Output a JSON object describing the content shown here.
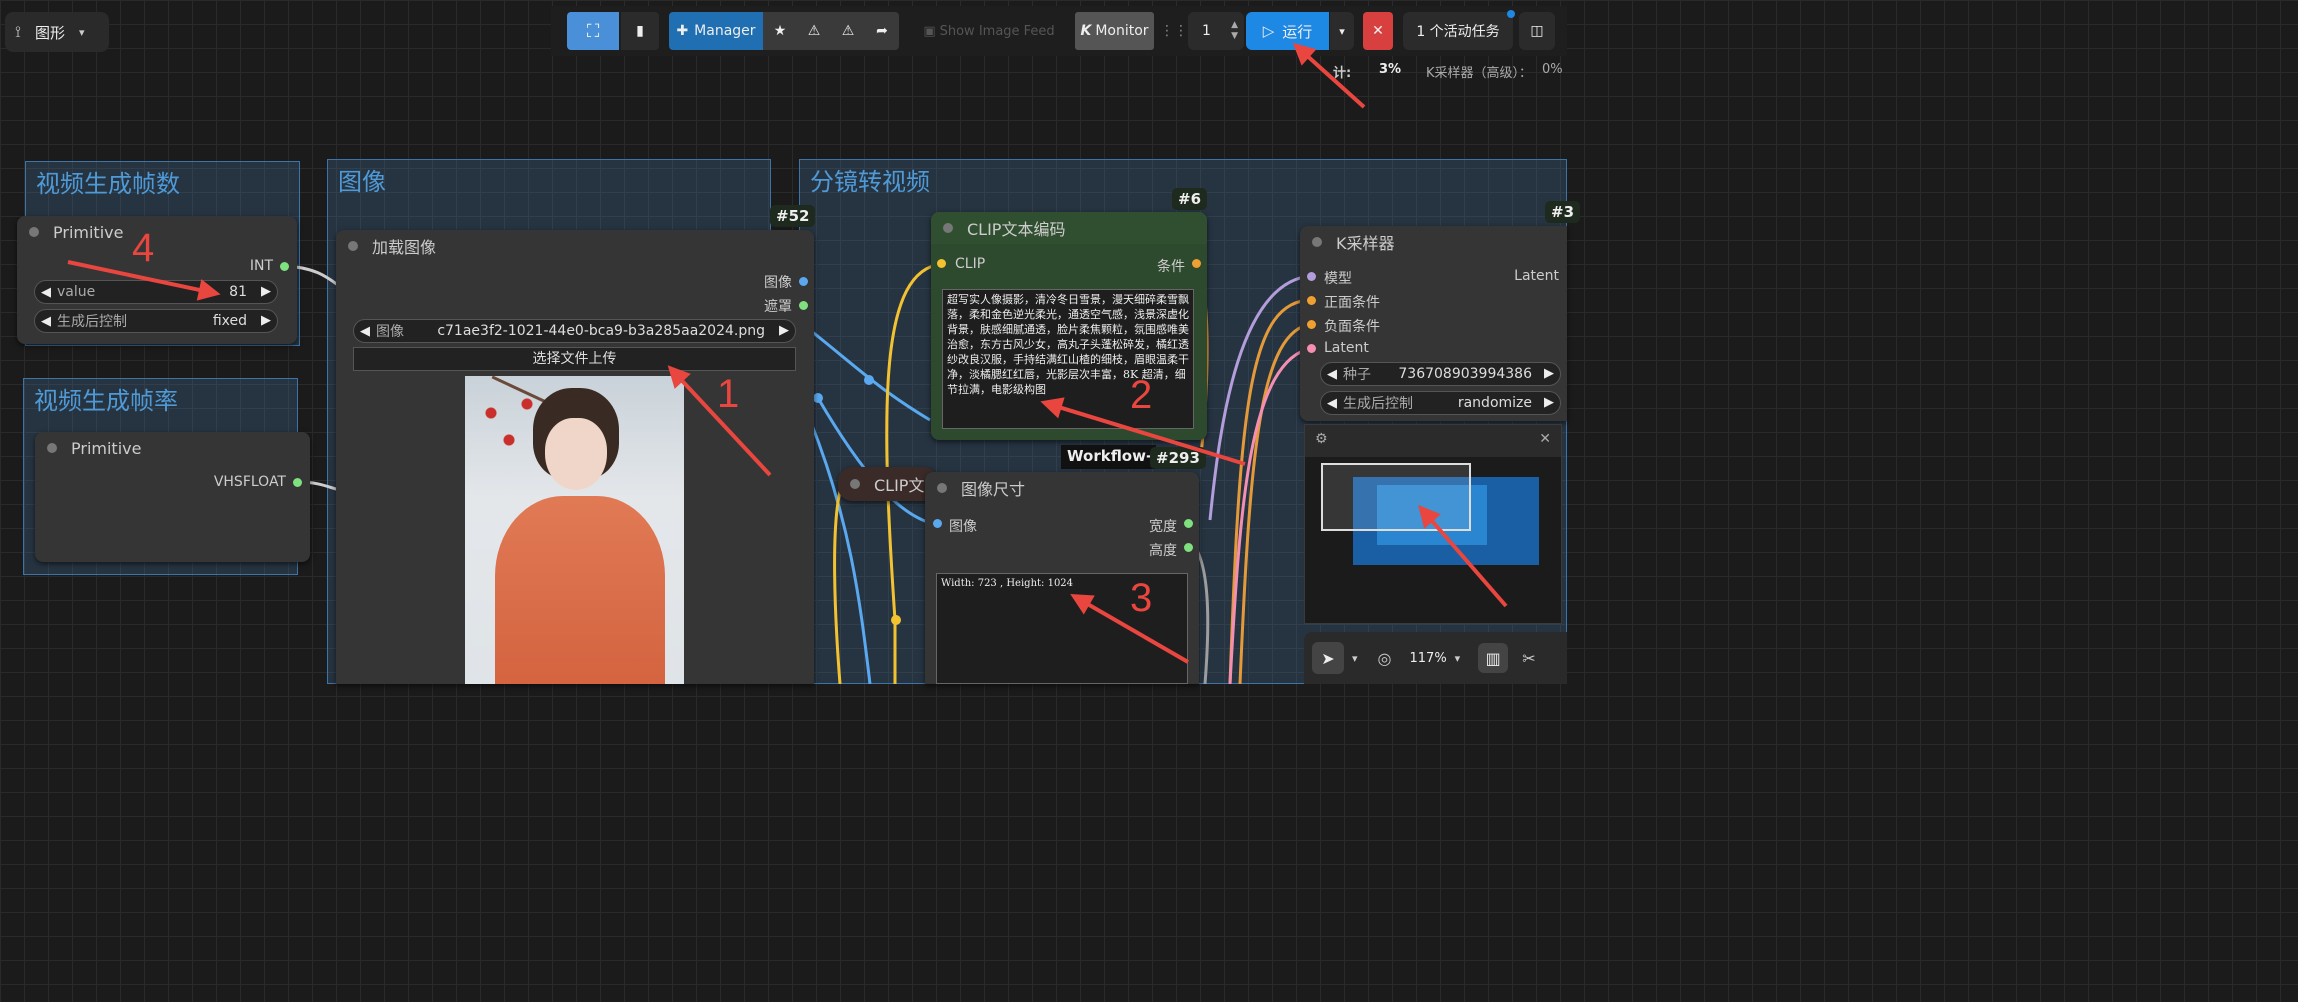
{
  "topbar": {
    "graph_menu": "图形",
    "manager": "Manager",
    "show_image_feed": "Show Image Feed",
    "monitor": "Monitor",
    "monitor_k": "K",
    "batch_count": "1",
    "run": "运行",
    "active_tasks": "1 个活动任务"
  },
  "progress": {
    "label": "计:",
    "value": "3%",
    "ksampler_label": "K采样器（高级）：",
    "ksampler_value": "0%"
  },
  "groups": {
    "g1": "视频生成帧数",
    "g2": "视频生成帧率",
    "g3": "图像",
    "g4": "分镜转视频"
  },
  "nodes": {
    "primitive1": {
      "title": "Primitive",
      "output": "INT",
      "value_label": "value",
      "value": "81",
      "control_label": "生成后控制",
      "control_value": "fixed"
    },
    "primitive2": {
      "title": "Primitive",
      "output": "VHSFLOAT"
    },
    "loadimage": {
      "badge": "#52",
      "title": "加载图像",
      "out_image": "图像",
      "out_mask": "遮罩",
      "image_label": "图像",
      "image_value": "c71ae3f2-1021-44e0-bca9-b3a285aa2024.png",
      "upload": "选择文件上传"
    },
    "clip": {
      "badge": "#6",
      "title": "CLIP文本编码",
      "in_clip": "CLIP",
      "out_cond": "条件",
      "text": "超写实人像摄影，清冷冬日雪景，漫天细碎柔雪飘落，柔和金色逆光柔光，通透空气感，浅景深虚化背景，肤感细腻通透，脸片柔焦颗粒，氛围感唯美治愈，东方古风少女，高丸子头蓬松碎发，橘红透纱改良汉服，手持结满红山楂的细枝，眉眼温柔干净，淡橘腮红红唇，光影层次丰富，8K 超清，细节拉满，电影级构图"
    },
    "clip2": {
      "title": "CLIP文"
    },
    "workflow": {
      "title": "Workflow-E",
      "badge": "#293"
    },
    "imagesize": {
      "title": "图像尺寸",
      "in_image": "图像",
      "out_width": "宽度",
      "out_height": "高度",
      "text": "Width: 723 , Height: 1024"
    },
    "ksampler": {
      "badge": "#3",
      "title": "K采样器",
      "in_model": "模型",
      "in_pos": "正面条件",
      "in_neg": "负面条件",
      "in_latent": "Latent",
      "out_latent": "Latent",
      "seed_label": "种子",
      "seed_value": "736708903994386",
      "control_label": "生成后控制",
      "control_value": "randomize"
    }
  },
  "minimap": {
    "zoom": "117%"
  },
  "annotations": [
    "1",
    "2",
    "3",
    "4"
  ],
  "colors": {
    "accent": "#1e88e5",
    "annotation": "#e8463f",
    "group": "#3d74a8"
  }
}
